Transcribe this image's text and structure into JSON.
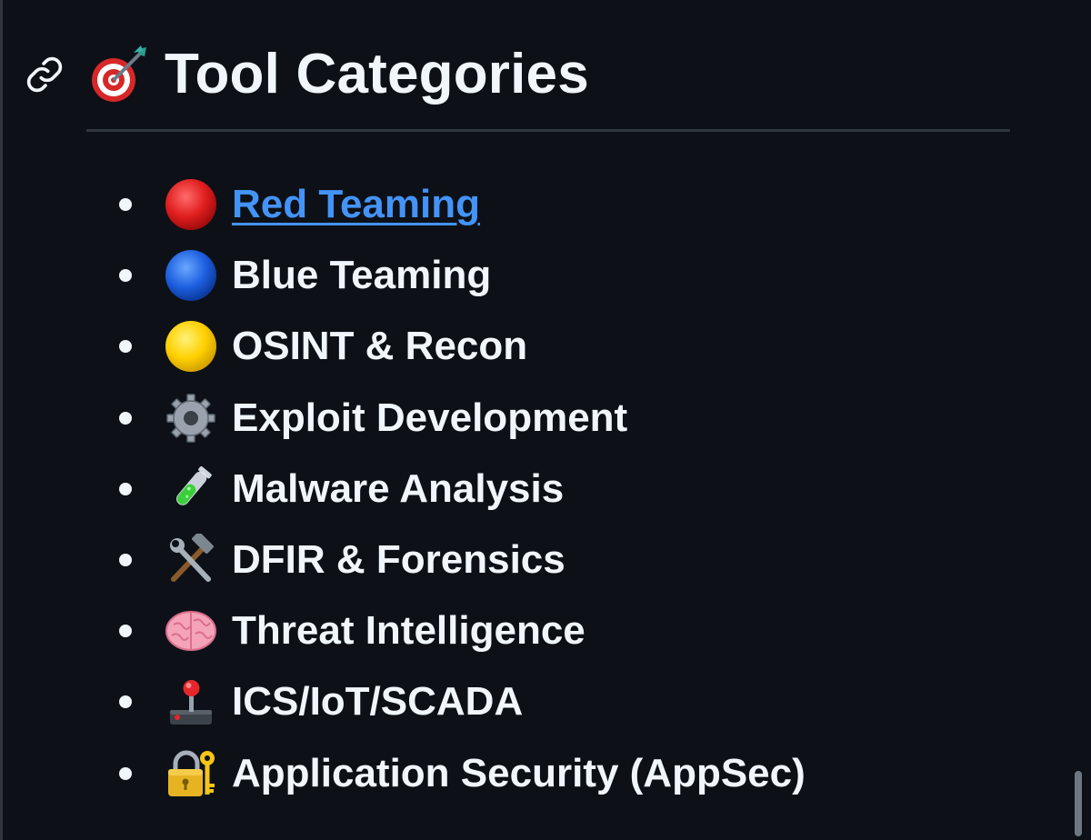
{
  "heading": {
    "anchor_icon": "link-icon",
    "emoji_icon": "direct-hit-icon",
    "title": "Tool Categories"
  },
  "categories": [
    {
      "icon": "red-circle-icon",
      "label": "Red Teaming",
      "is_link": true
    },
    {
      "icon": "blue-circle-icon",
      "label": "Blue Teaming",
      "is_link": false
    },
    {
      "icon": "yellow-circle-icon",
      "label": "OSINT & Recon",
      "is_link": false
    },
    {
      "icon": "gear-icon",
      "label": "Exploit Development",
      "is_link": false
    },
    {
      "icon": "test-tube-icon",
      "label": "Malware Analysis",
      "is_link": false
    },
    {
      "icon": "hammer-and-wrench-icon",
      "label": "DFIR & Forensics",
      "is_link": false
    },
    {
      "icon": "brain-icon",
      "label": "Threat Intelligence",
      "is_link": false
    },
    {
      "icon": "joystick-icon",
      "label": "ICS/IoT/SCADA",
      "is_link": false
    },
    {
      "icon": "locked-with-key-icon",
      "label": "Application Security (AppSec)",
      "is_link": false
    }
  ],
  "colors": {
    "background": "#0d1117",
    "text": "#f0f6fc",
    "link": "#4493f8",
    "divider": "#30363d"
  }
}
